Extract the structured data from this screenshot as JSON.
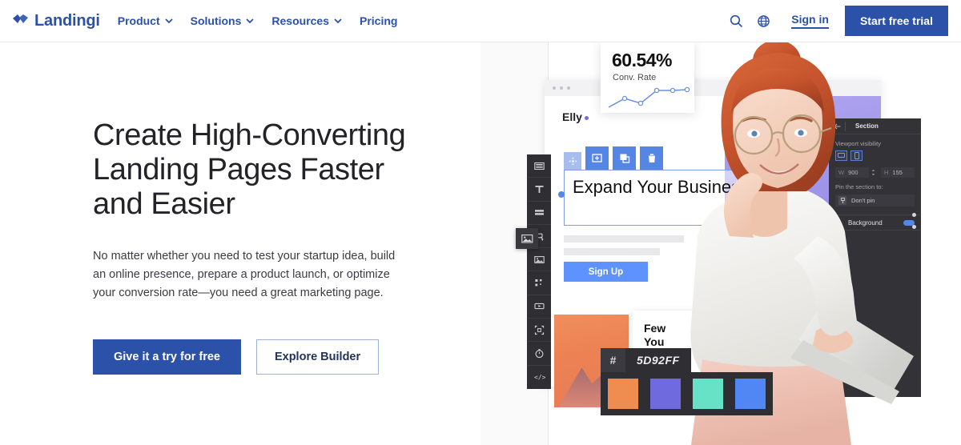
{
  "navbar": {
    "brand": "Landingi",
    "brand_color": "#2b52a8",
    "links": [
      {
        "label": "Product",
        "has_caret": true
      },
      {
        "label": "Solutions",
        "has_caret": true
      },
      {
        "label": "Resources",
        "has_caret": true
      },
      {
        "label": "Pricing",
        "has_caret": false
      }
    ],
    "search_icon": "search-icon",
    "language_icon": "globe-icon",
    "signin": "Sign in",
    "trial_button": "Start free trial"
  },
  "hero": {
    "heading": "Create High-Converting Landing Pages Faster and Easier",
    "subheading": "No matter whether you need to test your startup idea, build an online presence, prepare a product launch, or optimize your conversion rate—you need a great marketing page.",
    "primary_cta": "Give it a try for free",
    "secondary_cta": "Explore Builder"
  },
  "conversion_card": {
    "value": "60.54%",
    "label": "Conv. Rate"
  },
  "chart_data": {
    "type": "line",
    "title": "Conv. Rate",
    "x": [
      0,
      1,
      2,
      3,
      4,
      5
    ],
    "values": [
      12,
      38,
      22,
      62,
      63,
      66
    ],
    "categories": [
      "",
      "",
      "",
      "",
      "",
      ""
    ],
    "series": [
      {
        "name": "Conv. Rate",
        "values": [
          12,
          38,
          22,
          62,
          63,
          66
        ]
      }
    ],
    "line_color": "#6d8fe0",
    "marker_color": "#ffffff",
    "ylim": [
      0,
      80
    ],
    "xlabel": "",
    "ylabel": "",
    "grid": false,
    "legend": "none"
  },
  "builder": {
    "window_dots": 3,
    "logo": "Elly",
    "toolbar_items": [
      {
        "name": "section-icon",
        "label": "Section"
      },
      {
        "name": "text-icon",
        "label": "Text"
      },
      {
        "name": "rows-icon",
        "label": "Rows"
      },
      {
        "name": "button-icon",
        "label": "Button"
      },
      {
        "name": "image-icon",
        "label": "Image"
      },
      {
        "name": "social-icon",
        "label": "Social"
      },
      {
        "name": "video-icon",
        "label": "Video"
      },
      {
        "name": "box-icon",
        "label": "Box"
      },
      {
        "name": "timer-icon",
        "label": "Timer"
      },
      {
        "name": "code-icon",
        "label": "Code"
      }
    ],
    "dragged_widget": "image-icon",
    "selection_toolbar": [
      {
        "name": "move-handle-icon",
        "label": "Move"
      },
      {
        "name": "add-icon",
        "label": "Add"
      },
      {
        "name": "duplicate-icon",
        "label": "Duplicate"
      },
      {
        "name": "delete-icon",
        "label": "Delete"
      }
    ],
    "selected_heading": "Expand Your Business",
    "signup_button": "Sign Up",
    "second_card_text": "Few\nYou",
    "accent_color": "#5d92ff"
  },
  "right_panel": {
    "back_icon": "arrow-left-icon",
    "title": "Section",
    "viewport_label": "Viewport visibility",
    "viewport_options": [
      {
        "name": "desktop-icon",
        "label": "Desktop"
      },
      {
        "name": "mobile-icon",
        "label": "Mobile"
      }
    ],
    "width_key": "W",
    "width_value": "900",
    "height_key": "H",
    "height_value": "155",
    "pin_label": "Pin the section to:",
    "pin_value": "Don't pin",
    "background_label": "Background"
  },
  "color_picker": {
    "hash": "#",
    "hex": "5D92FF",
    "swatches": [
      "#ef8c4f",
      "#6f6ade",
      "#67e2c7",
      "#5186f5"
    ]
  }
}
